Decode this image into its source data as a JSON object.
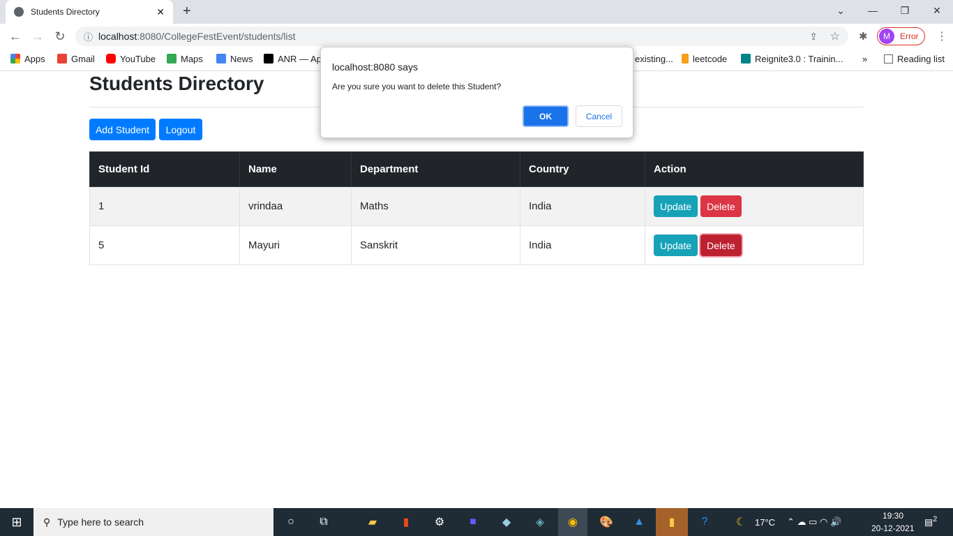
{
  "browser": {
    "tab_title": "Students Directory",
    "url_host": "localhost",
    "url_path": ":8080/CollegeFestEvent/students/list",
    "profile_initial": "M",
    "profile_status": "Error",
    "bookmarks": [
      {
        "label": "Apps",
        "color": "#4285f4"
      },
      {
        "label": "Gmail",
        "color": "#ea4335"
      },
      {
        "label": "YouTube",
        "color": "#ff0000"
      },
      {
        "label": "Maps",
        "color": "#34a853"
      },
      {
        "label": "News",
        "color": "#4285f4"
      },
      {
        "label": "ANR — Ap",
        "color": "#000000"
      },
      {
        "label": "existing...",
        "color": "#ffffff"
      },
      {
        "label": "leetcode",
        "color": "#f89f1b"
      },
      {
        "label": "Reignite3.0 : Trainin...",
        "color": "#038387"
      }
    ],
    "reading_list": "Reading list"
  },
  "page": {
    "title": "Students Directory",
    "add_button": "Add Student",
    "logout_button": "Logout",
    "columns": [
      "Student Id",
      "Name",
      "Department",
      "Country",
      "Action"
    ],
    "rows": [
      {
        "id": "1",
        "name": "vrindaa",
        "department": "Maths",
        "country": "India"
      },
      {
        "id": "5",
        "name": "Mayuri",
        "department": "Sanskrit",
        "country": "India"
      }
    ],
    "update_label": "Update",
    "delete_label": "Delete"
  },
  "dialog": {
    "heading": "localhost:8080 says",
    "message": "Are you sure you want to delete this Student?",
    "ok": "OK",
    "cancel": "Cancel"
  },
  "taskbar": {
    "search_placeholder": "Type here to search",
    "weather": "17°C",
    "time": "19:30",
    "date": "20-12-2021",
    "notifications": "2"
  },
  "colors": {
    "primary": "#007bff",
    "info": "#17a2b8",
    "danger": "#dc3545",
    "danger_active": "#bd2130",
    "dark": "#212529"
  }
}
